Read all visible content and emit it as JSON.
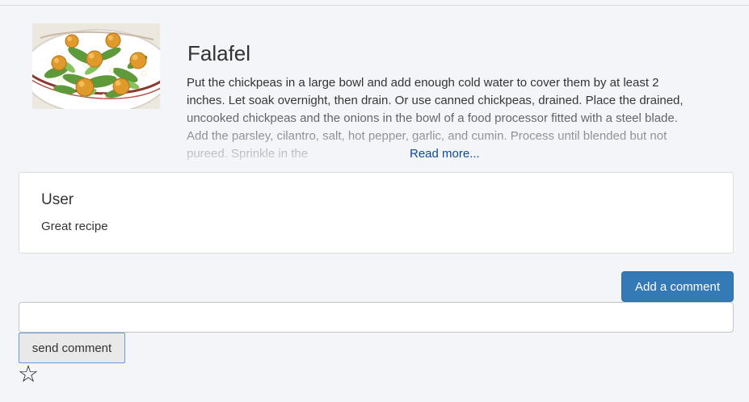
{
  "recipe": {
    "title": "Falafel",
    "description": "Put the chickpeas in a large bowl and add enough cold water to cover them by at least 2 inches. Let soak overnight, then drain. Or use canned chickpeas, drained. Place the drained, uncooked chickpeas and the onions in the bowl of a food processor fitted with a steel blade. Add the parsley, cilantro, salt, hot pepper, garlic, and cumin. Process until blended but not pureed. Sprinkle in the",
    "read_more_label": "Read more...",
    "image_icon": "falafel-photo"
  },
  "comments": [
    {
      "user": "User",
      "text": "Great recipe"
    }
  ],
  "actions": {
    "add_comment_label": "Add a comment",
    "comment_input_value": "",
    "comment_input_placeholder": "",
    "send_label": "send comment",
    "favorite_icon": "star-outline-icon"
  },
  "colors": {
    "primary": "#337ab7",
    "link": "#0b4a9a",
    "background": "#f4f5f9"
  }
}
